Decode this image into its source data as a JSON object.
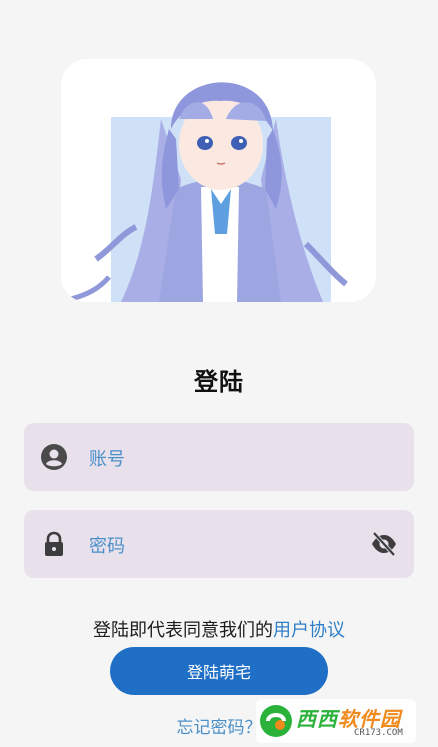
{
  "title": "登陆",
  "account_field": {
    "placeholder": "账号",
    "icon": "account-circle-icon"
  },
  "password_field": {
    "placeholder": "密码",
    "icon": "lock-icon",
    "toggle_icon": "eye-off-icon"
  },
  "agreement": {
    "prefix": "登陆即代表同意我们的",
    "link": "用户协议"
  },
  "login_button": {
    "label": "登陆萌宅"
  },
  "forgot_password": {
    "label": "忘记密码？"
  },
  "watermark": {
    "brand_a": "西西",
    "brand_b": "软件园",
    "site": "CR173.COM"
  },
  "colors": {
    "accent": "#1f6fc6",
    "link": "#2f7fc8",
    "field_bg": "#e8e1ec",
    "background": "#f5f5f5"
  }
}
